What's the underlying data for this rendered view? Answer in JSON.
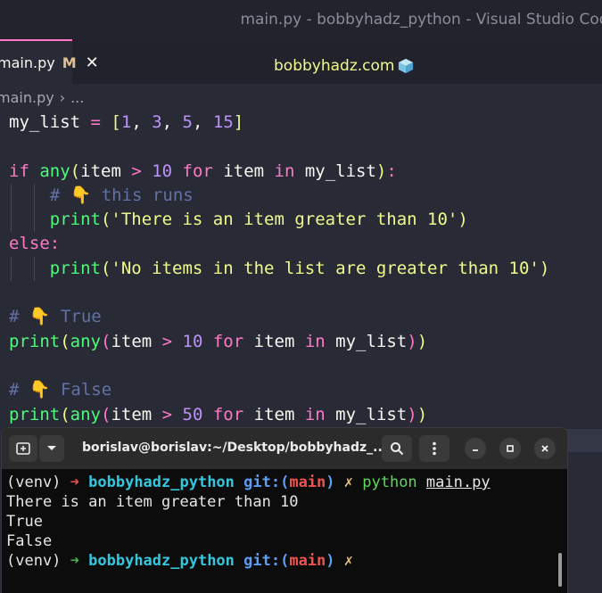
{
  "window": {
    "title": "main.py - bobbyhadz_python - Visual Studio Code"
  },
  "tab": {
    "label": "main.py",
    "modified": "M",
    "close": "✕"
  },
  "brand": {
    "text": "bobbyhadz.com"
  },
  "breadcrumb": {
    "file": "main.py",
    "sep": "›",
    "more": "..."
  },
  "code": {
    "l1": {
      "a": "my_list",
      "b": " = ",
      "c": "[",
      "d": "1",
      "e": ", ",
      "f": "3",
      "g": ", ",
      "h": "5",
      "i": ", ",
      "j": "15",
      "k": "]"
    },
    "l3": {
      "kw": "if",
      "fn": "any",
      "p1": "(",
      "v1": "item ",
      "op": "> ",
      "num": "10",
      "kw2": " for",
      "v2": " item ",
      "kw3": "in",
      "v3": " my_list",
      "p2": ")",
      "col": ":"
    },
    "l4": {
      "comment": "# 👇 this runs"
    },
    "l5": {
      "fn": "print",
      "p1": "(",
      "str": "'There is an item greater than 10'",
      "p2": ")"
    },
    "l6": {
      "kw": "else",
      "col": ":"
    },
    "l7": {
      "fn": "print",
      "p1": "(",
      "str": "'No items in the list are greater than 10'",
      "p2": ")"
    },
    "l9": {
      "comment": "# 👇 True"
    },
    "l10": {
      "fn": "print",
      "p1": "(",
      "fn2": "any",
      "p2": "(",
      "v1": "item ",
      "op": "> ",
      "num": "10",
      "kw": " for",
      "v2": " item ",
      "kw2": "in",
      "v3": " my_list",
      "p3": ")",
      "p4": ")"
    },
    "l12": {
      "comment": "# 👇 False"
    },
    "l13": {
      "fn": "print",
      "p1": "(",
      "fn2": "any",
      "p2": "(",
      "v1": "item ",
      "op": "> ",
      "num": "50",
      "kw": " for",
      "v2": " item ",
      "kw2": "in",
      "v3": " my_list",
      "p3": ")",
      "p4": ")"
    }
  },
  "terminal": {
    "title": "borislav@borislav:~/Desktop/bobbyhadz_...",
    "lines": {
      "p1_venv": "(venv) ",
      "p1_arrow": "➜",
      "p1_dir": " bobbyhadz_python ",
      "p1_git": "git:(",
      "p1_branch": "main",
      "p1_gitc": ")",
      "p1_x": " ✗ ",
      "p1_cmd": "python",
      "p1_file": "main.py",
      "out1": "There is an item greater than 10",
      "out2": "True",
      "out3": "False",
      "p2_venv": "(venv) ",
      "p2_arrow": "➜",
      "p2_dir": " bobbyhadz_python ",
      "p2_git": "git:(",
      "p2_branch": "main",
      "p2_gitc": ")",
      "p2_x": " ✗"
    }
  },
  "icons": [
    "new-tab-icon",
    "dropdown-icon",
    "search-icon",
    "menu-icon",
    "minimize-icon",
    "maximize-icon",
    "close-icon",
    "cube-icon",
    "pointing-down-emoji"
  ]
}
